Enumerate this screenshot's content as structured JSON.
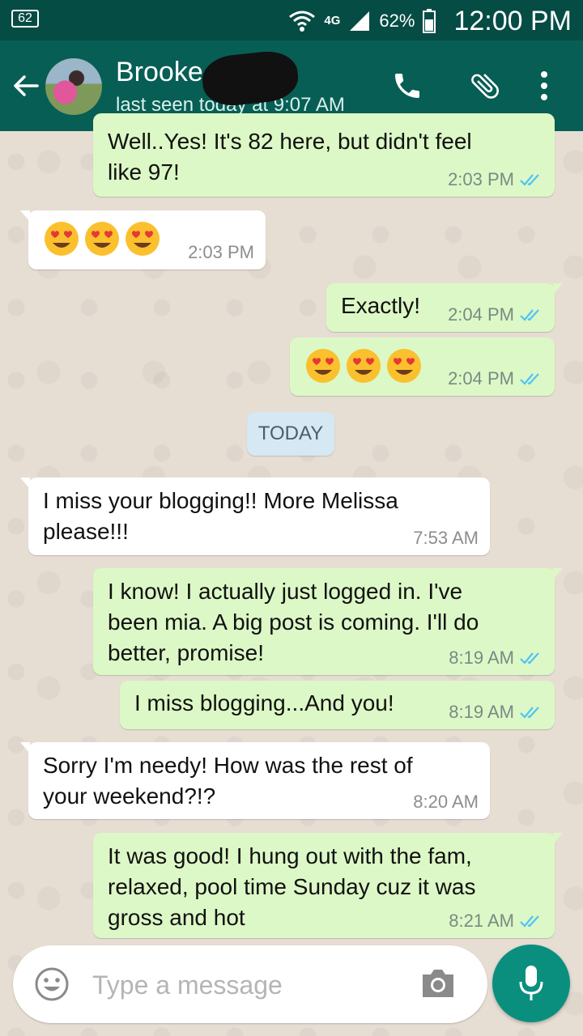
{
  "status_bar": {
    "notification_count": "62",
    "network": "4G",
    "battery": "62%",
    "time": "12:00 PM"
  },
  "header": {
    "contact_name": "Brooke",
    "last_seen": "last seen today at 9:07 AM"
  },
  "messages": [
    {
      "direction": "out",
      "text": "Well..Yes! It's 82 here, but didn't feel\nlike 97!",
      "time": "2:03 PM",
      "read": true
    },
    {
      "direction": "in",
      "emoji": "heart-eyes x3",
      "time": "2:03 PM"
    },
    {
      "direction": "out",
      "text": "Exactly!",
      "time": "2:04 PM",
      "read": true
    },
    {
      "direction": "out",
      "emoji": "heart-eyes x3",
      "time": "2:04 PM",
      "read": true
    },
    {
      "direction": "in",
      "text": "I miss your blogging!! More Melissa\nplease!!!",
      "time": "7:53 AM"
    },
    {
      "direction": "out",
      "text": "I know! I actually just logged in. I've\nbeen mia. A big post is coming. I'll do\nbetter, promise!",
      "time": "8:19 AM",
      "read": true
    },
    {
      "direction": "out",
      "text": "I miss blogging...And you!",
      "time": "8:19 AM",
      "read": true
    },
    {
      "direction": "in",
      "text": "Sorry I'm needy! How was the rest of\nyour weekend?!?",
      "time": "8:20 AM"
    },
    {
      "direction": "out",
      "text": "It was good! I hung out with the fam,\nrelaxed, pool time Sunday cuz it was\ngross and hot",
      "time": "8:21 AM",
      "read": true
    }
  ],
  "date_divider": "TODAY",
  "composer": {
    "placeholder": "Type a message"
  },
  "icons": {
    "back": "back-arrow-icon",
    "call": "phone-icon",
    "attach": "paperclip-icon",
    "menu": "more-vert-icon",
    "emoji": "smiley-icon",
    "camera": "camera-icon",
    "mic": "mic-icon"
  },
  "colors": {
    "header": "#075e54",
    "status_bar": "#054c44",
    "outgoing_bubble": "#dcf8c6",
    "incoming_bubble": "#ffffff",
    "read_ticks": "#4fc3f7",
    "mic_button": "#0a8f7f"
  }
}
